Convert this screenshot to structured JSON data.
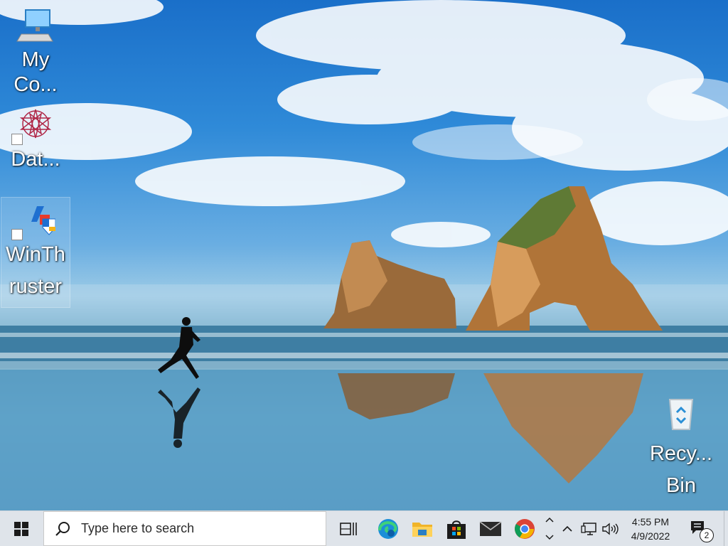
{
  "desktop": {
    "icons": [
      {
        "name": "my-computer",
        "label_line1": "My",
        "label_line2": "Co..."
      },
      {
        "name": "dat",
        "label_line1": "Dat...",
        "label_line2": ""
      },
      {
        "name": "winthruster",
        "label_line1": "WinTh",
        "label_line2": "ruster"
      },
      {
        "name": "recycle-bin",
        "label_line1": "Recy...",
        "label_line2": "Bin"
      }
    ],
    "selected_icon": "winthruster"
  },
  "taskbar": {
    "search_placeholder": "Type here to search",
    "pinned_apps": [
      "task-view",
      "microsoft-edge",
      "file-explorer",
      "microsoft-store",
      "mail",
      "google-chrome"
    ],
    "clock": {
      "time": "4:55 PM",
      "date": "4/9/2022"
    },
    "notification_count": "2"
  },
  "colors": {
    "taskbar_bg": "#dfe4ea",
    "search_bg": "#ffffff",
    "windows_logo": "#1b1b1b"
  }
}
